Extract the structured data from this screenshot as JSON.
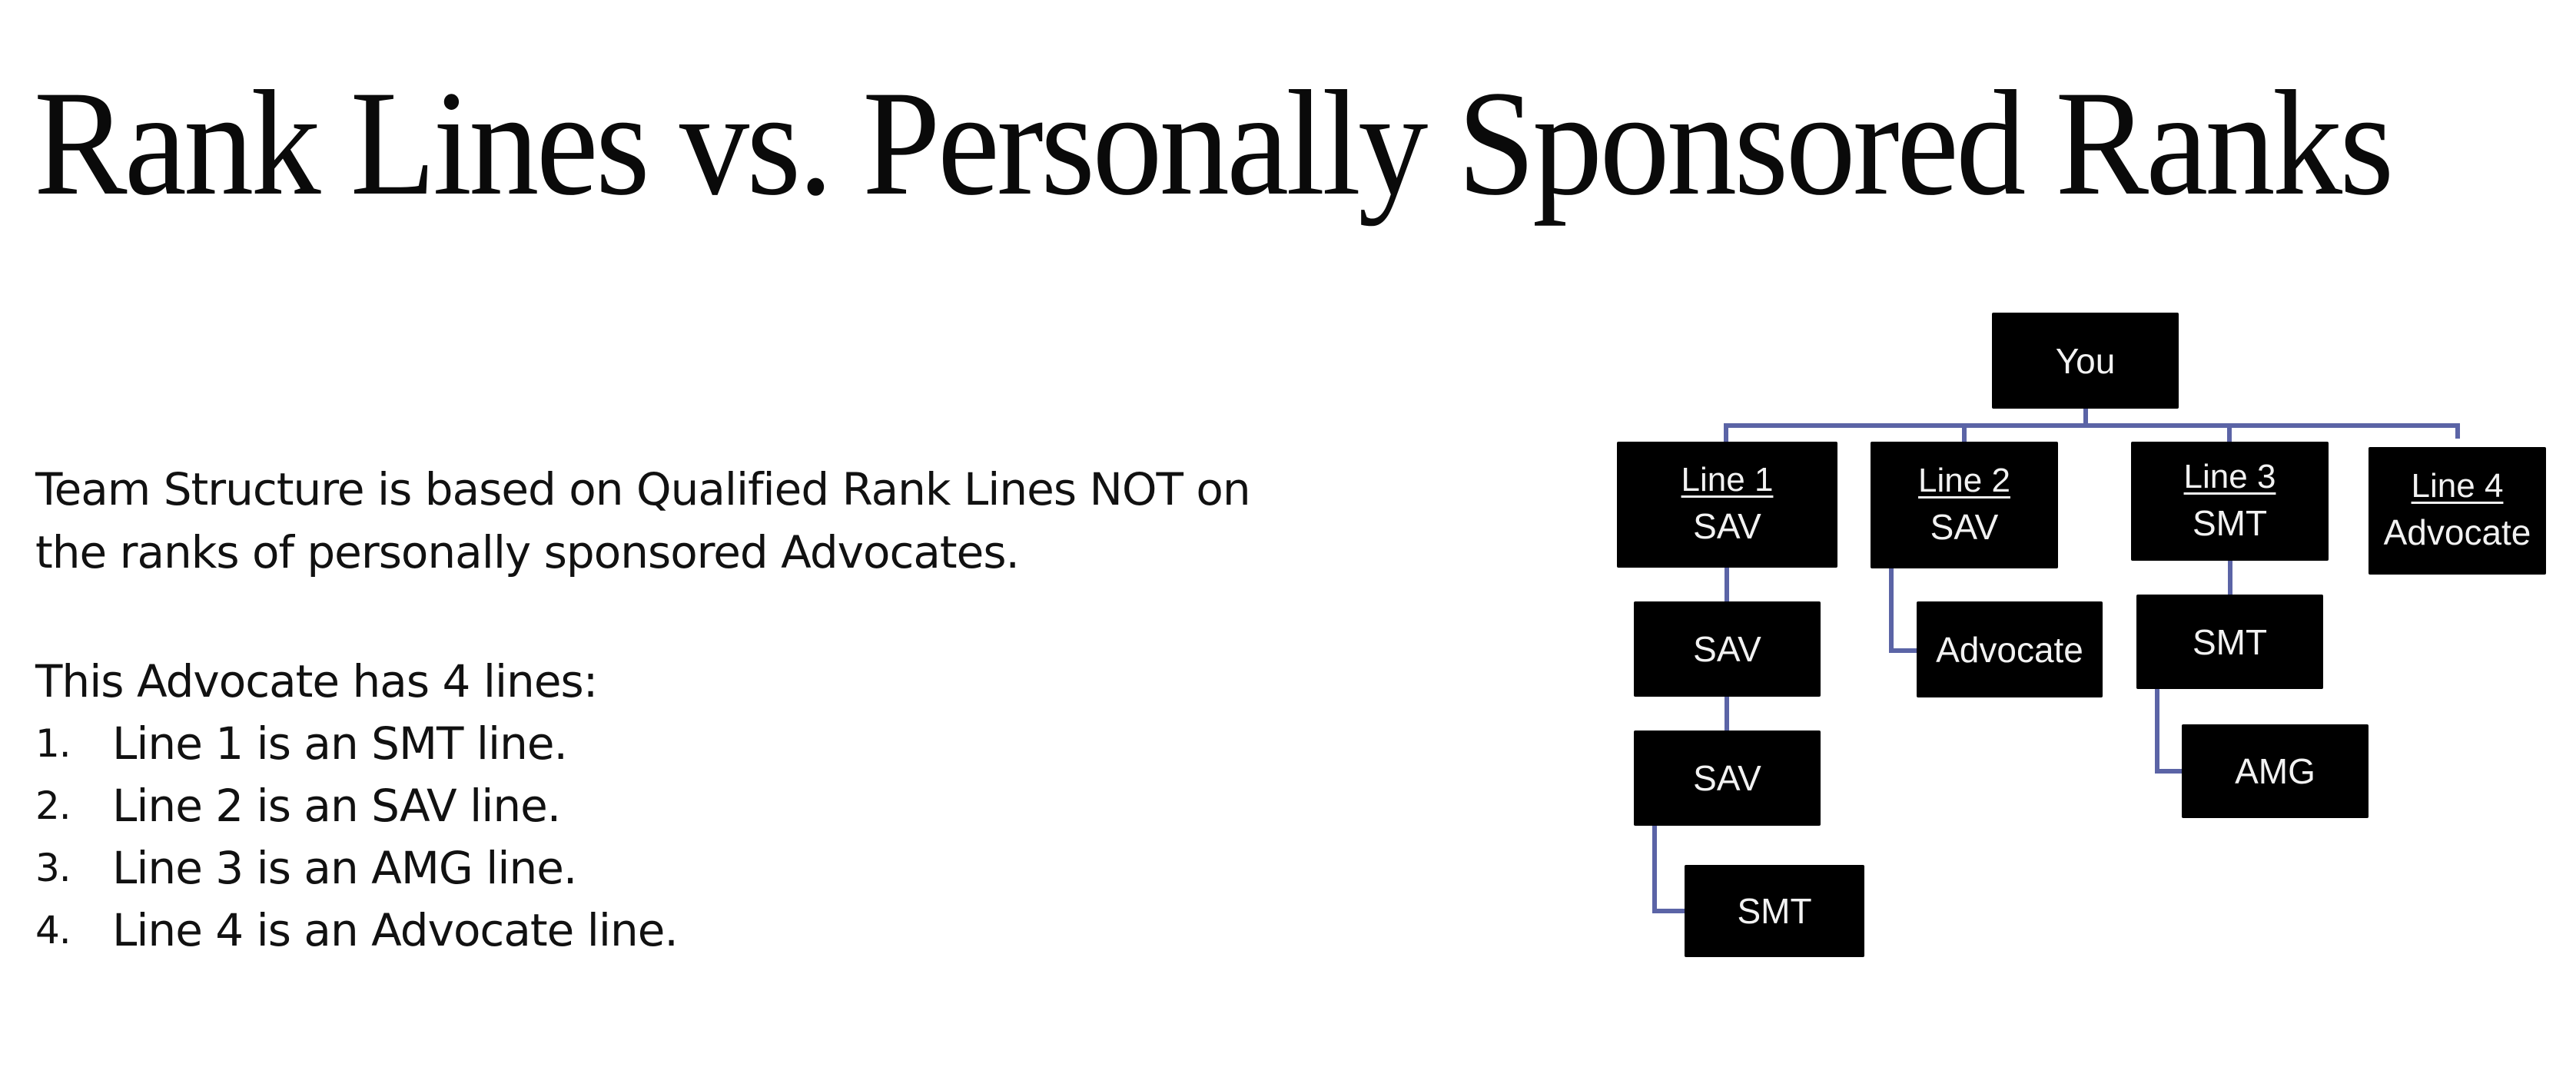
{
  "slide": {
    "title": "Rank Lines vs. Personally Sponsored Ranks",
    "paragraph": [
      "Team Structure is based on Qualified Rank Lines NOT on",
      "the ranks of personally sponsored Advocates."
    ],
    "intro": "This Advocate has 4 lines:",
    "list": [
      {
        "num": "1.",
        "text": "Line 1 is an SMT line."
      },
      {
        "num": "2.",
        "text": "Line 2 is an SAV line."
      },
      {
        "num": "3.",
        "text": "Line 3 is an AMG line."
      },
      {
        "num": "4.",
        "text": "Line 4 is an Advocate line."
      }
    ]
  },
  "diagram": {
    "connector_color": "#5b64a6",
    "node_color": "#000000",
    "root": {
      "label": "You"
    },
    "lines": [
      {
        "heading": "Line 1",
        "rank": "SAV",
        "descendants": [
          "SAV",
          "SAV",
          "SMT"
        ]
      },
      {
        "heading": "Line 2",
        "rank": "SAV",
        "descendants": [
          "Advocate"
        ]
      },
      {
        "heading": "Line 3",
        "rank": "SMT",
        "descendants": [
          "SMT",
          "AMG"
        ]
      },
      {
        "heading": "Line 4",
        "rank": "Advocate",
        "descendants": []
      }
    ]
  }
}
